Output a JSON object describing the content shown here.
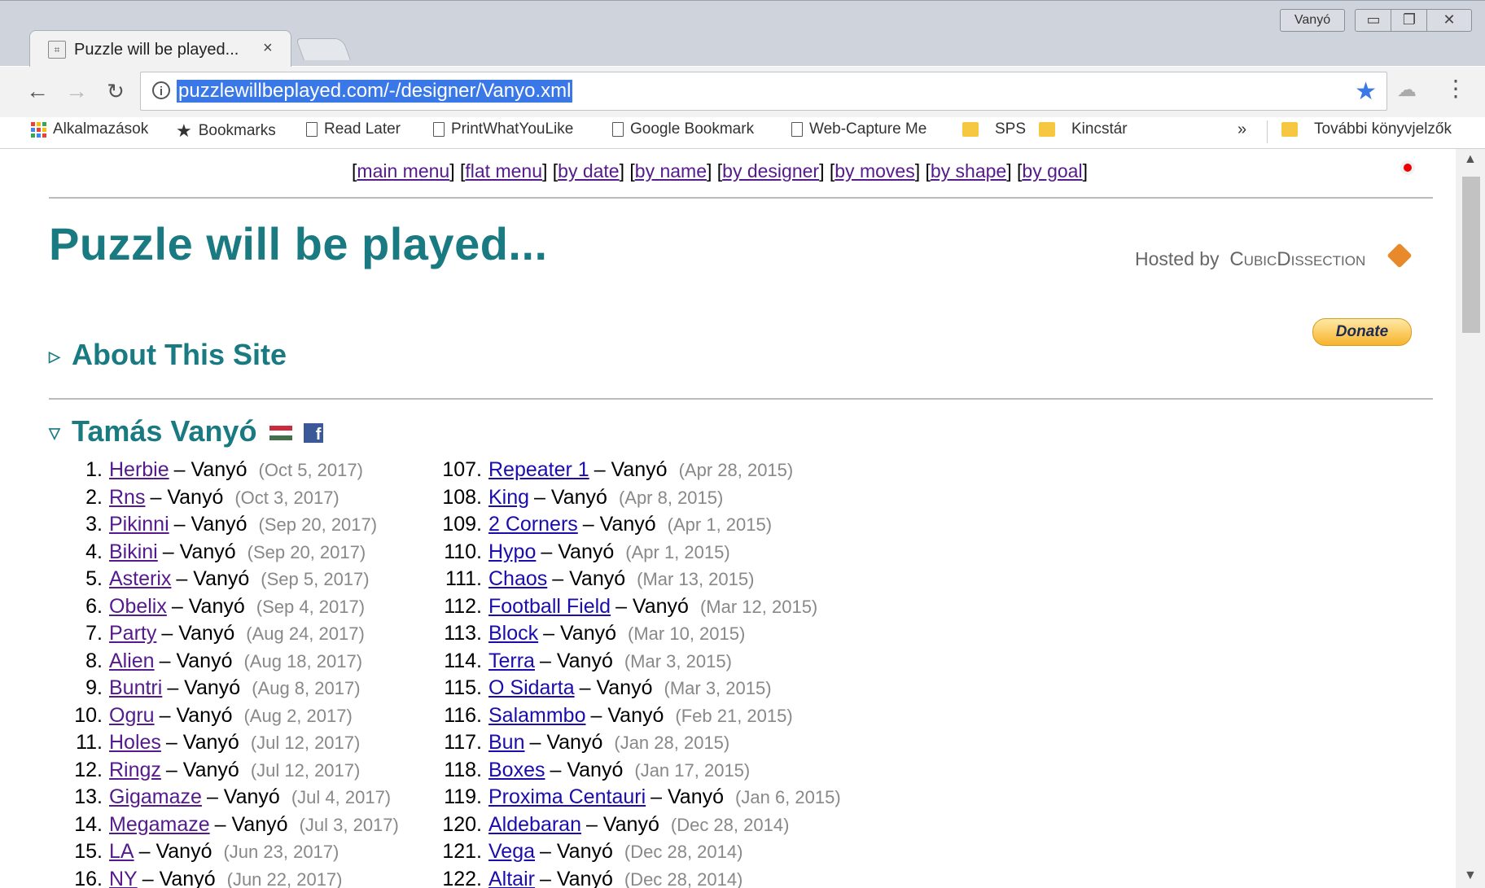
{
  "window": {
    "profile": "Vanyó",
    "tab_title": "Puzzle will be played...",
    "tab_close": "×"
  },
  "toolbar": {
    "url": "puzzlewillbeplayed.com/-/designer/Vanyo.xml",
    "back_icon": "←",
    "forward_icon": "→",
    "reload_icon": "C",
    "menu_icon": "⋮"
  },
  "bookmarks": {
    "items": [
      {
        "label": "Alkalmazások",
        "icon": "apps-grid-icon"
      },
      {
        "label": "Bookmarks",
        "icon": "star-icon"
      },
      {
        "label": "Read Later",
        "icon": "page-icon"
      },
      {
        "label": "PrintWhatYouLike",
        "icon": "page-icon"
      },
      {
        "label": "Google Bookmark",
        "icon": "page-icon"
      },
      {
        "label": "Web-Capture Me",
        "icon": "page-icon"
      },
      {
        "label": "SPS",
        "icon": "folder-icon"
      },
      {
        "label": "Kincstár",
        "icon": "folder-icon"
      }
    ],
    "more": "»",
    "other": "További könyvjelzők"
  },
  "nav": {
    "main_menu": "main menu",
    "flat_menu": "flat menu",
    "by_date": "by date",
    "by_name": "by name",
    "by_designer": "by designer",
    "by_moves": "by moves",
    "by_shape": "by shape",
    "by_goal": "by goal"
  },
  "page": {
    "title": "Puzzle will be played...",
    "hosted_by": "Hosted by",
    "host_name": "CubicDissection",
    "donate": "Donate",
    "about": "About This Site",
    "designer": "Tamás Vanyó"
  },
  "puzzles_left": [
    {
      "n": "1.",
      "name": "Herbie",
      "by": "– Vanyó",
      "date": "(Oct 5, 2017)"
    },
    {
      "n": "2.",
      "name": "Rns",
      "by": "– Vanyó",
      "date": "(Oct 3, 2017)"
    },
    {
      "n": "3.",
      "name": "Pikinni",
      "by": "– Vanyó",
      "date": "(Sep 20, 2017)"
    },
    {
      "n": "4.",
      "name": "Bikini",
      "by": "– Vanyó",
      "date": "(Sep 20, 2017)"
    },
    {
      "n": "5.",
      "name": "Asterix",
      "by": "– Vanyó",
      "date": "(Sep 5, 2017)"
    },
    {
      "n": "6.",
      "name": "Obelix",
      "by": "– Vanyó",
      "date": "(Sep 4, 2017)"
    },
    {
      "n": "7.",
      "name": "Party",
      "by": "– Vanyó",
      "date": "(Aug 24, 2017)"
    },
    {
      "n": "8.",
      "name": "Alien",
      "by": "– Vanyó",
      "date": "(Aug 18, 2017)"
    },
    {
      "n": "9.",
      "name": "Buntri",
      "by": "– Vanyó",
      "date": "(Aug 8, 2017)"
    },
    {
      "n": "10.",
      "name": "Ogru",
      "by": "– Vanyó",
      "date": "(Aug 2, 2017)"
    },
    {
      "n": "11.",
      "name": "Holes",
      "by": "– Vanyó",
      "date": "(Jul 12, 2017)"
    },
    {
      "n": "12.",
      "name": "Ringz",
      "by": "– Vanyó",
      "date": "(Jul 12, 2017)"
    },
    {
      "n": "13.",
      "name": "Gigamaze",
      "by": "– Vanyó",
      "date": "(Jul 4, 2017)"
    },
    {
      "n": "14.",
      "name": "Megamaze",
      "by": "– Vanyó",
      "date": "(Jul 3, 2017)"
    },
    {
      "n": "15.",
      "name": "LA",
      "by": "– Vanyó",
      "date": "(Jun 23, 2017)"
    },
    {
      "n": "16.",
      "name": "NY",
      "by": "– Vanyó",
      "date": "(Jun 22, 2017)"
    }
  ],
  "puzzles_right": [
    {
      "n": "107.",
      "name": "Repeater 1",
      "by": "– Vanyó",
      "date": "(Apr 28, 2015)"
    },
    {
      "n": "108.",
      "name": "King",
      "by": "– Vanyó",
      "date": "(Apr 8, 2015)"
    },
    {
      "n": "109.",
      "name": "2 Corners",
      "by": "– Vanyó",
      "date": "(Apr 1, 2015)"
    },
    {
      "n": "110.",
      "name": "Hypo",
      "by": "– Vanyó",
      "date": "(Apr 1, 2015)"
    },
    {
      "n": "111.",
      "name": "Chaos",
      "by": "– Vanyó",
      "date": "(Mar 13, 2015)"
    },
    {
      "n": "112.",
      "name": "Football Field",
      "by": "– Vanyó",
      "date": "(Mar 12, 2015)"
    },
    {
      "n": "113.",
      "name": "Block",
      "by": "– Vanyó",
      "date": "(Mar 10, 2015)"
    },
    {
      "n": "114.",
      "name": "Terra",
      "by": "– Vanyó",
      "date": "(Mar 3, 2015)"
    },
    {
      "n": "115.",
      "name": "O Sidarta",
      "by": "– Vanyó",
      "date": "(Mar 3, 2015)"
    },
    {
      "n": "116.",
      "name": "Salammbo",
      "by": "– Vanyó",
      "date": "(Feb 21, 2015)"
    },
    {
      "n": "117.",
      "name": "Bun",
      "by": "– Vanyó",
      "date": "(Jan 28, 2015)"
    },
    {
      "n": "118.",
      "name": "Boxes",
      "by": "– Vanyó",
      "date": "(Jan 17, 2015)"
    },
    {
      "n": "119.",
      "name": "Proxima Centauri",
      "by": "– Vanyó",
      "date": "(Jan 6, 2015)"
    },
    {
      "n": "120.",
      "name": "Aldebaran",
      "by": "– Vanyó",
      "date": "(Dec 28, 2014)"
    },
    {
      "n": "121.",
      "name": "Vega",
      "by": "– Vanyó",
      "date": "(Dec 28, 2014)"
    },
    {
      "n": "122.",
      "name": "Altair",
      "by": "– Vanyó",
      "date": "(Dec 28, 2014)"
    }
  ],
  "colors": {
    "accent": "#1a7a82",
    "visited_link": "#551a8b",
    "link": "#1a0dab",
    "url_highlight": "#3b78e7"
  }
}
